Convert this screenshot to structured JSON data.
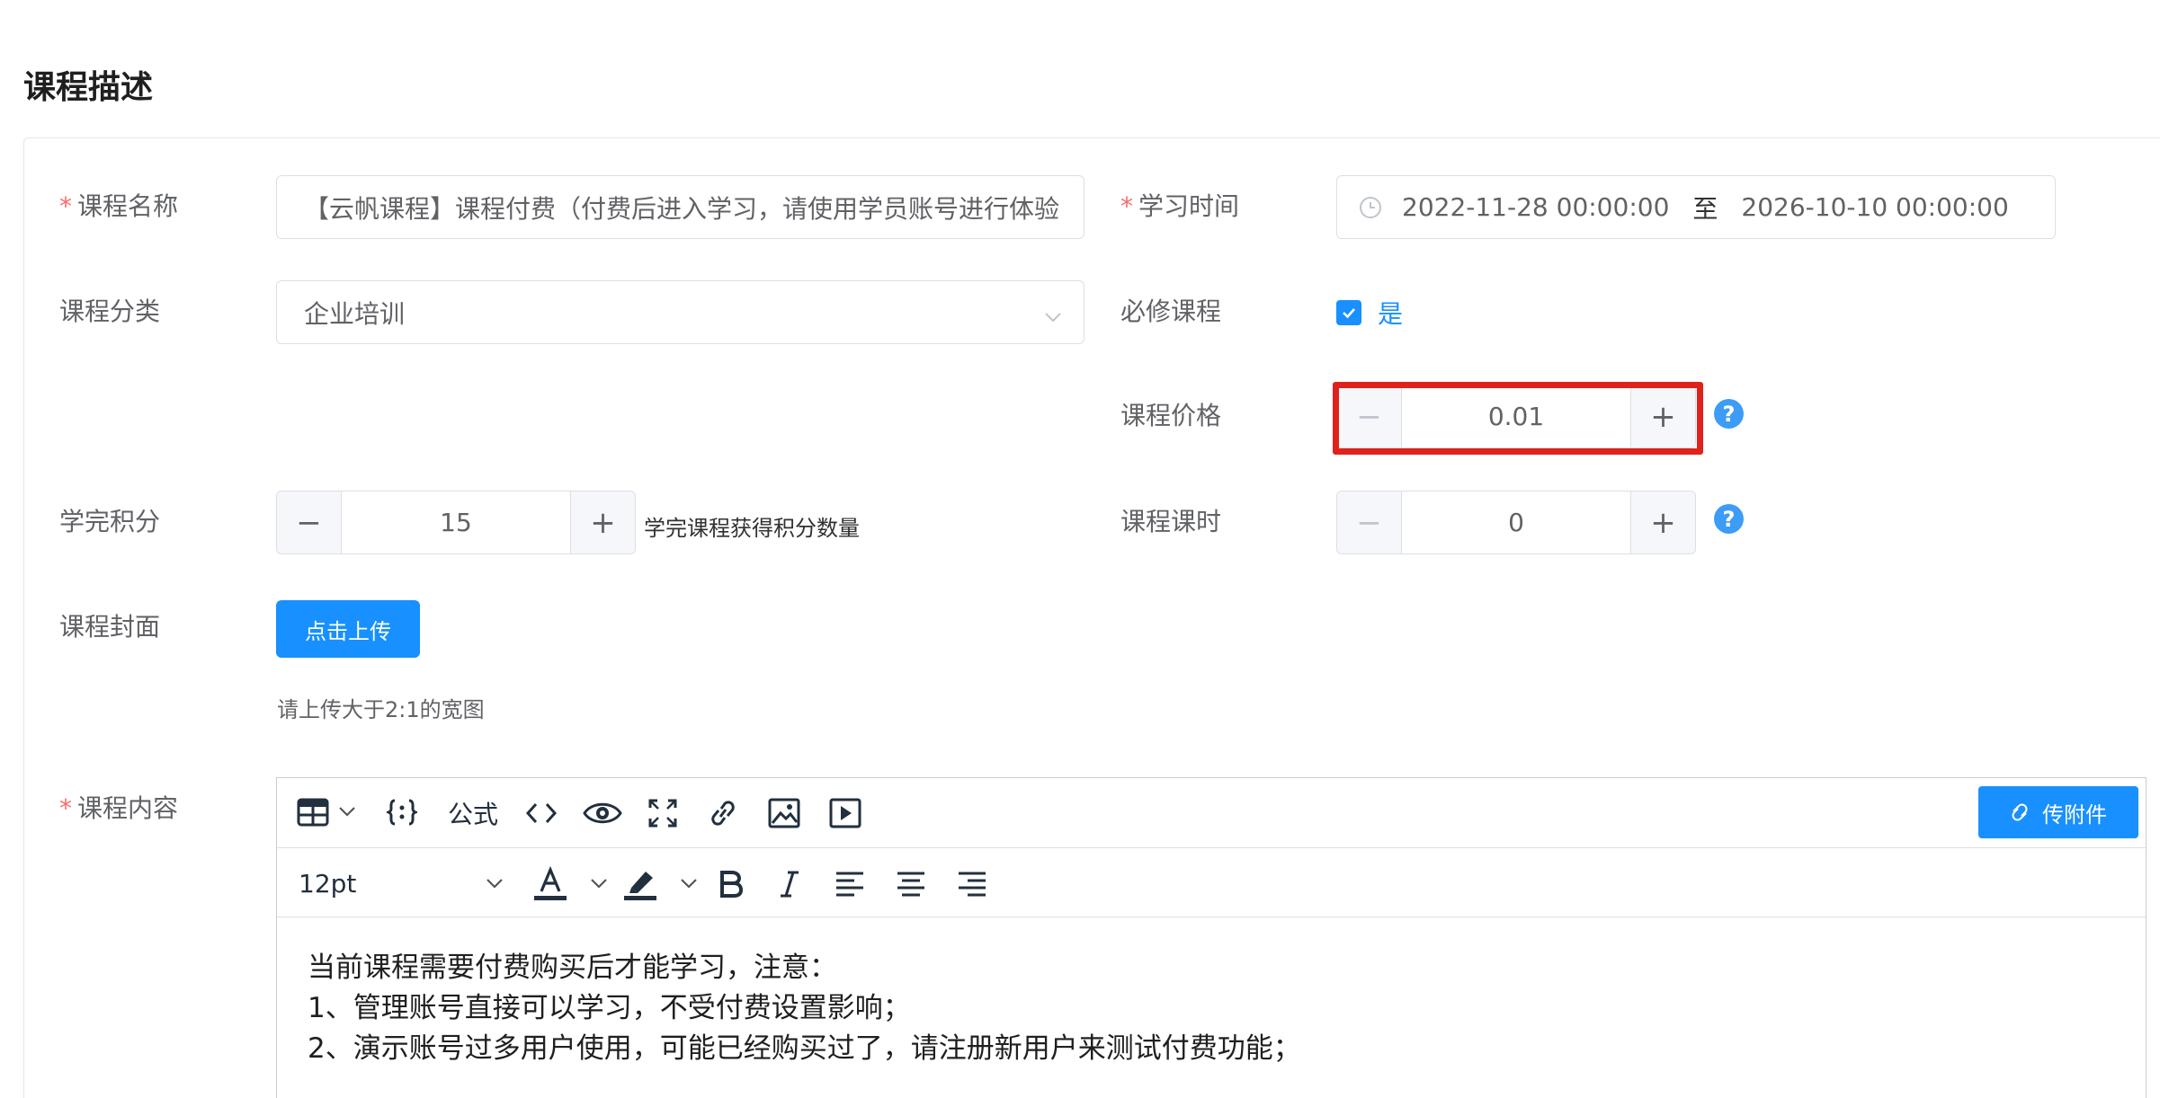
{
  "section_title": "课程描述",
  "form": {
    "course_name": {
      "label": "课程名称",
      "required_mark": "*",
      "value": "【云帆课程】课程付费（付费后进入学习，请使用学员账号进行体验"
    },
    "study_time": {
      "label": "学习时间",
      "required_mark": "*",
      "start": "2022-11-28 00:00:00",
      "separator": "至",
      "end": "2026-10-10 00:00:00"
    },
    "category": {
      "label": "课程分类",
      "value": "企业培训"
    },
    "required_course": {
      "label": "必修课程",
      "checked": true,
      "option_label": "是"
    },
    "price": {
      "label": "课程价格",
      "value": "0.01",
      "highlighted": true
    },
    "points": {
      "label": "学完积分",
      "value": "15",
      "hint": "学完课程获得积分数量"
    },
    "hours": {
      "label": "课程课时",
      "value": "0"
    },
    "cover": {
      "label": "课程封面",
      "button_label": "点击上传",
      "hint": "请上传大于2:1的宽图"
    },
    "content": {
      "label": "课程内容",
      "required_mark": "*",
      "toolbar": {
        "formula_label": "公式",
        "attach_label": "传附件",
        "font_size": "12pt"
      },
      "lines": [
        "当前课程需要付费购买后才能学习，注意：",
        "1、管理账号直接可以学习，不受付费设置影响；",
        "2、演示账号过多用户使用，可能已经购买过了，请注册新用户来测试付费功能；"
      ]
    }
  },
  "icons": {
    "minus": "−",
    "plus": "+",
    "help": "?"
  },
  "colors": {
    "primary": "#1890ff",
    "required": "#f56c6c",
    "highlight": "#e0221c",
    "help": "#3d9cf5"
  }
}
